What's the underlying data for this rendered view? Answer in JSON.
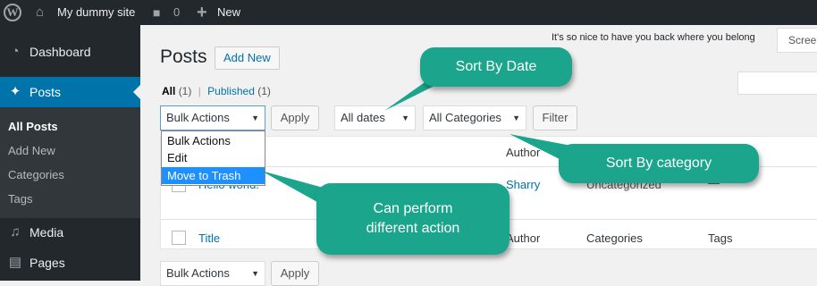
{
  "admin_bar": {
    "site_name": "My dummy site",
    "comment_count": "0",
    "new_label": "New"
  },
  "sidebar": {
    "items": [
      {
        "label": "Dashboard",
        "icon": "dashboard-icon"
      },
      {
        "label": "Posts",
        "icon": "pushpin-icon",
        "active": true
      },
      {
        "label": "Media",
        "icon": "media-icon"
      },
      {
        "label": "Pages",
        "icon": "pages-icon"
      }
    ],
    "submenu": [
      "All Posts",
      "Add New",
      "Categories",
      "Tags"
    ]
  },
  "header": {
    "welcome": "It's so nice to have you back where you belong",
    "screen_options": "Screen Options",
    "title": "Posts",
    "add_new": "Add New"
  },
  "filters": {
    "all_label": "All",
    "all_count": "(1)",
    "sep": "|",
    "published_label": "Published",
    "published_count": "(1)",
    "bulk_actions": "Bulk Actions",
    "apply": "Apply",
    "all_dates": "All dates",
    "all_categories": "All Categories",
    "filter": "Filter"
  },
  "bulk_dropdown": {
    "options": [
      "Bulk Actions",
      "Edit",
      "Move to Trash"
    ],
    "highlighted": "Move to Trash"
  },
  "table": {
    "columns": [
      "Title",
      "Author",
      "Categories",
      "Tags"
    ],
    "row": {
      "title": "Hello world!",
      "author": "Sharry",
      "category": "Uncategorized",
      "tags": "—"
    }
  },
  "callouts": {
    "sort_by_date": "Sort By Date",
    "sort_by_category": "Sort By category",
    "action_line1": "Can perform",
    "action_line2": "different action"
  },
  "colors": {
    "admin_bar": "#23282d",
    "active_menu": "#0073aa",
    "callout": "#1aa58c",
    "highlight": "#1e90ff"
  }
}
